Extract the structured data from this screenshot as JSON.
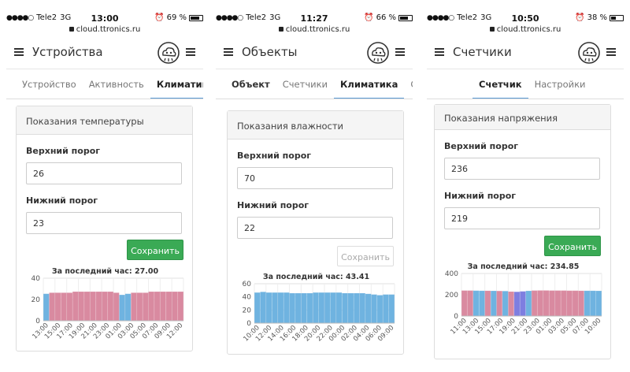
{
  "screens": [
    {
      "status": {
        "carrier": "Tele2",
        "network": "3G",
        "time": "13:00",
        "battery": "69 %"
      },
      "url": "cloud.ttronics.ru",
      "title": "Устройства",
      "tabs": [
        "Устройство",
        "Активность",
        "Климатика"
      ],
      "card_title": "Показания температуры",
      "upper_label": "Верхний порог",
      "upper_value": "26",
      "lower_label": "Нижний порог",
      "lower_value": "23",
      "save_label": "Сохранить",
      "chart_title": "За последний час: 27.00"
    },
    {
      "status": {
        "carrier": "Tele2",
        "network": "3G",
        "time": "11:27",
        "battery": "66 %"
      },
      "url": "cloud.ttronics.ru",
      "title": "Объекты",
      "tabs": [
        "Объект",
        "Счетчики",
        "Климатика",
        "Сигна"
      ],
      "card_title": "Показания влажности",
      "upper_label": "Верхний порог",
      "upper_value": "70",
      "lower_label": "Нижний порог",
      "lower_value": "22",
      "save_label": "Сохранить",
      "chart_title": "За последний час: 43.41"
    },
    {
      "status": {
        "carrier": "Tele2",
        "network": "3G",
        "time": "10:50",
        "battery": "38 %"
      },
      "url": "cloud.ttronics.ru",
      "title": "Счетчики",
      "tabs": [
        "Счетчик",
        "Настройки"
      ],
      "card_title": "Показания напряжения",
      "upper_label": "Верхний порог",
      "upper_value": "236",
      "lower_label": "Нижний порог",
      "lower_value": "219",
      "save_label": "Сохранить",
      "chart_title": "За последний час: 234.85"
    }
  ],
  "colors": {
    "blue": "#6fb3e0",
    "pink": "#d98aa0",
    "purple": "#7e7ee0",
    "green": "#3aaa55"
  },
  "chart_data": [
    {
      "type": "bar",
      "ylim": [
        0,
        40
      ],
      "yticks": [
        0,
        20,
        40
      ],
      "xticks": [
        "13:00",
        "15:00",
        "17:00",
        "19:00",
        "21:00",
        "23:00",
        "01:00",
        "03:00",
        "05:00",
        "07:00",
        "09:00",
        "12:00"
      ],
      "values": [
        25,
        26,
        26,
        26,
        26,
        27,
        27,
        27,
        27,
        27,
        27,
        27,
        26,
        24,
        25,
        26,
        26,
        26,
        27,
        27,
        27,
        27,
        27,
        27
      ],
      "bar_colors": [
        "b",
        "p",
        "p",
        "p",
        "p",
        "p",
        "p",
        "p",
        "p",
        "p",
        "p",
        "p",
        "p",
        "b",
        "b",
        "p",
        "p",
        "p",
        "p",
        "p",
        "p",
        "p",
        "p",
        "p"
      ]
    },
    {
      "type": "bar",
      "ylim": [
        0,
        60
      ],
      "yticks": [
        0,
        20,
        40,
        60
      ],
      "xticks": [
        "10:00",
        "12:00",
        "14:00",
        "16:00",
        "18:00",
        "20:00",
        "22:00",
        "00:00",
        "02:00",
        "04:00",
        "06:00",
        "09:00"
      ],
      "values": [
        46,
        47,
        46,
        46,
        46,
        46,
        45,
        45,
        45,
        45,
        46,
        46,
        46,
        46,
        46,
        45,
        45,
        45,
        45,
        44,
        43,
        42,
        43,
        43
      ],
      "bar_colors": [
        "b",
        "b",
        "b",
        "b",
        "b",
        "b",
        "b",
        "b",
        "b",
        "b",
        "b",
        "b",
        "b",
        "b",
        "b",
        "b",
        "b",
        "b",
        "b",
        "b",
        "b",
        "b",
        "b",
        "b"
      ]
    },
    {
      "type": "bar",
      "ylim": [
        0,
        400
      ],
      "yticks": [
        0,
        200,
        400
      ],
      "xticks": [
        "11:00",
        "13:00",
        "15:00",
        "17:00",
        "19:00",
        "21:00",
        "23:00",
        "01:00",
        "03:00",
        "05:00",
        "07:00",
        "10:00"
      ],
      "values": [
        236,
        236,
        235,
        234,
        234,
        233,
        232,
        231,
        226,
        224,
        228,
        233,
        236,
        237,
        237,
        236,
        236,
        236,
        235,
        235,
        234,
        234,
        234,
        233
      ],
      "bar_colors": [
        "p",
        "p",
        "b",
        "b",
        "p",
        "b",
        "p",
        "b",
        "p",
        "u",
        "u",
        "b",
        "p",
        "p",
        "p",
        "p",
        "p",
        "p",
        "p",
        "p",
        "p",
        "b",
        "b",
        "b"
      ]
    }
  ]
}
